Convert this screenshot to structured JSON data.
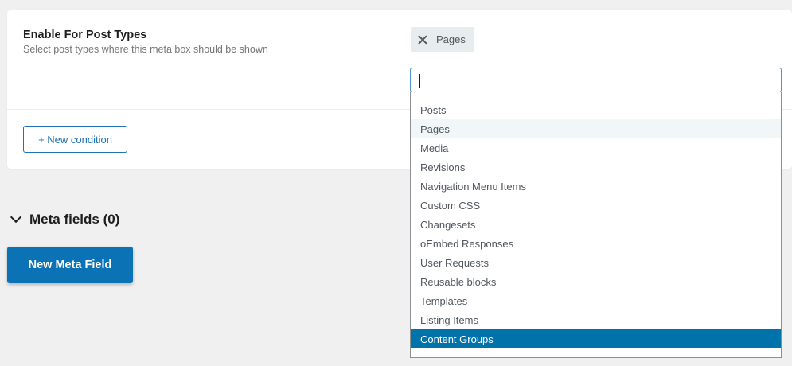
{
  "condition": {
    "title": "Enable For Post Types",
    "description": "Select post types where this meta box should be shown",
    "selected_chip": "Pages",
    "new_condition_label": "+ New condition"
  },
  "meta": {
    "title": "Meta fields (0)",
    "new_button_label": "New Meta Field"
  },
  "dropdown": {
    "search_value": "",
    "options": [
      "Posts",
      "Pages",
      "Media",
      "Revisions",
      "Navigation Menu Items",
      "Custom CSS",
      "Changesets",
      "oEmbed Responses",
      "User Requests",
      "Reusable blocks",
      "Templates",
      "Listing Items",
      "Content Groups"
    ],
    "hovered": "Pages",
    "highlighted": "Content Groups"
  },
  "colors": {
    "primary": "#0b72b6",
    "highlight": "#0073aa",
    "accent_border": "#2271b1"
  }
}
